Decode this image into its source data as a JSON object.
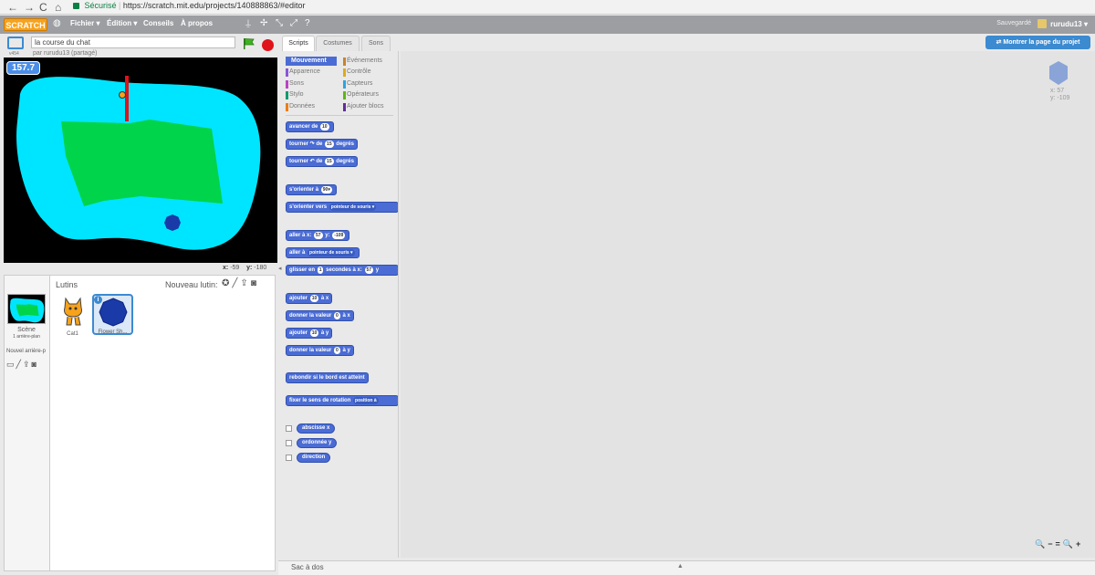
{
  "browser": {
    "back": "←",
    "forward": "→",
    "reload": "C",
    "home": "⌂",
    "secure": "Sécurisé",
    "url": "https://scratch.mit.edu/projects/140888863/#editor"
  },
  "menubar": {
    "logo": "SCRATCH",
    "file": "Fichier ▾",
    "edit": "Édition ▾",
    "tips": "Conseils",
    "about": "À propos",
    "saved": "Sauvegardé",
    "username": "rurudu13 ▾"
  },
  "project": {
    "version": "v454",
    "title": "la course du chat",
    "author": "par rurudu13 (partagé)"
  },
  "stage": {
    "timer": "157.7",
    "x_label": "x:",
    "x_value": "-59",
    "y_label": "y:",
    "y_value": "-180"
  },
  "sprites": {
    "scene_label": "Scène",
    "scene_sub": "1 arrière-plan",
    "new_backdrop": "Nouvel arrière-p",
    "header": "Lutins",
    "new_sprite": "Nouveau lutin:",
    "list": [
      {
        "name": "Cat1"
      },
      {
        "name": "Flower Sh..."
      }
    ],
    "info": "i"
  },
  "tabs": [
    "Scripts",
    "Costumes",
    "Sons"
  ],
  "categories": {
    "left": [
      {
        "label": "Mouvement",
        "color": "#4a6cd4"
      },
      {
        "label": "Apparence",
        "color": "#8a55d7"
      },
      {
        "label": "Sons",
        "color": "#bb42c3"
      },
      {
        "label": "Stylo",
        "color": "#0e9a6c"
      },
      {
        "label": "Données",
        "color": "#ee7d16"
      }
    ],
    "right": [
      {
        "label": "Événements",
        "color": "#c88330"
      },
      {
        "label": "Contrôle",
        "color": "#e1a91a"
      },
      {
        "label": "Capteurs",
        "color": "#2ca5e2"
      },
      {
        "label": "Opérateurs",
        "color": "#5cb712"
      },
      {
        "label": "Ajouter blocs",
        "color": "#632d99"
      }
    ]
  },
  "blocks": {
    "move": {
      "pre": "avancer de",
      "v": "10"
    },
    "turn_r": {
      "pre": "tourner ↷ de",
      "v": "15",
      "post": "degrés"
    },
    "turn_l": {
      "pre": "tourner ↶ de",
      "v": "15",
      "post": "degrés"
    },
    "point_dir": {
      "pre": "s'orienter à",
      "v": "90▾"
    },
    "point_to": {
      "pre": "s'orienter vers",
      "v": "pointeur de souris ▾"
    },
    "goto_xy": {
      "pre": "aller à x:",
      "v1": "57",
      "mid": "y:",
      "v2": "-109"
    },
    "goto": {
      "pre": "aller à",
      "v": "pointeur de souris ▾"
    },
    "glide": {
      "pre": "glisser en",
      "v1": "1",
      "mid": "secondes à x:",
      "v2": "57",
      "post": "y"
    },
    "change_x": {
      "pre": "ajouter",
      "v": "10",
      "post": "à x"
    },
    "set_x": {
      "pre": "donner la valeur",
      "v": "0",
      "post": "à x"
    },
    "change_y": {
      "pre": "ajouter",
      "v": "10",
      "post": "à y"
    },
    "set_y": {
      "pre": "donner la valeur",
      "v": "0",
      "post": "à y"
    },
    "bounce": {
      "pre": "rebondir si le bord est atteint"
    },
    "rotation": {
      "pre": "fixer le sens de rotation",
      "v": "position à"
    },
    "xpos": "abscisse x",
    "ypos": "ordonnée y",
    "direction": "direction"
  },
  "scripts_area": {
    "project_page_button": "Montrer la page du projet",
    "sprite_x": "x: 57",
    "sprite_y": "y: -109",
    "zoom_out": "🔍−",
    "zoom_reset": "=",
    "zoom_in": "🔍+"
  },
  "backpack": {
    "label": "Sac à dos",
    "arrow": "▲"
  },
  "colors": {
    "motion": "#4a6cd4",
    "stage_water": "#00e5ff",
    "stage_grass": "#00d44a",
    "sprite_blue": "#1a3aa8",
    "menubar": "#9c9ea2",
    "accent": "#3c8ad0"
  }
}
